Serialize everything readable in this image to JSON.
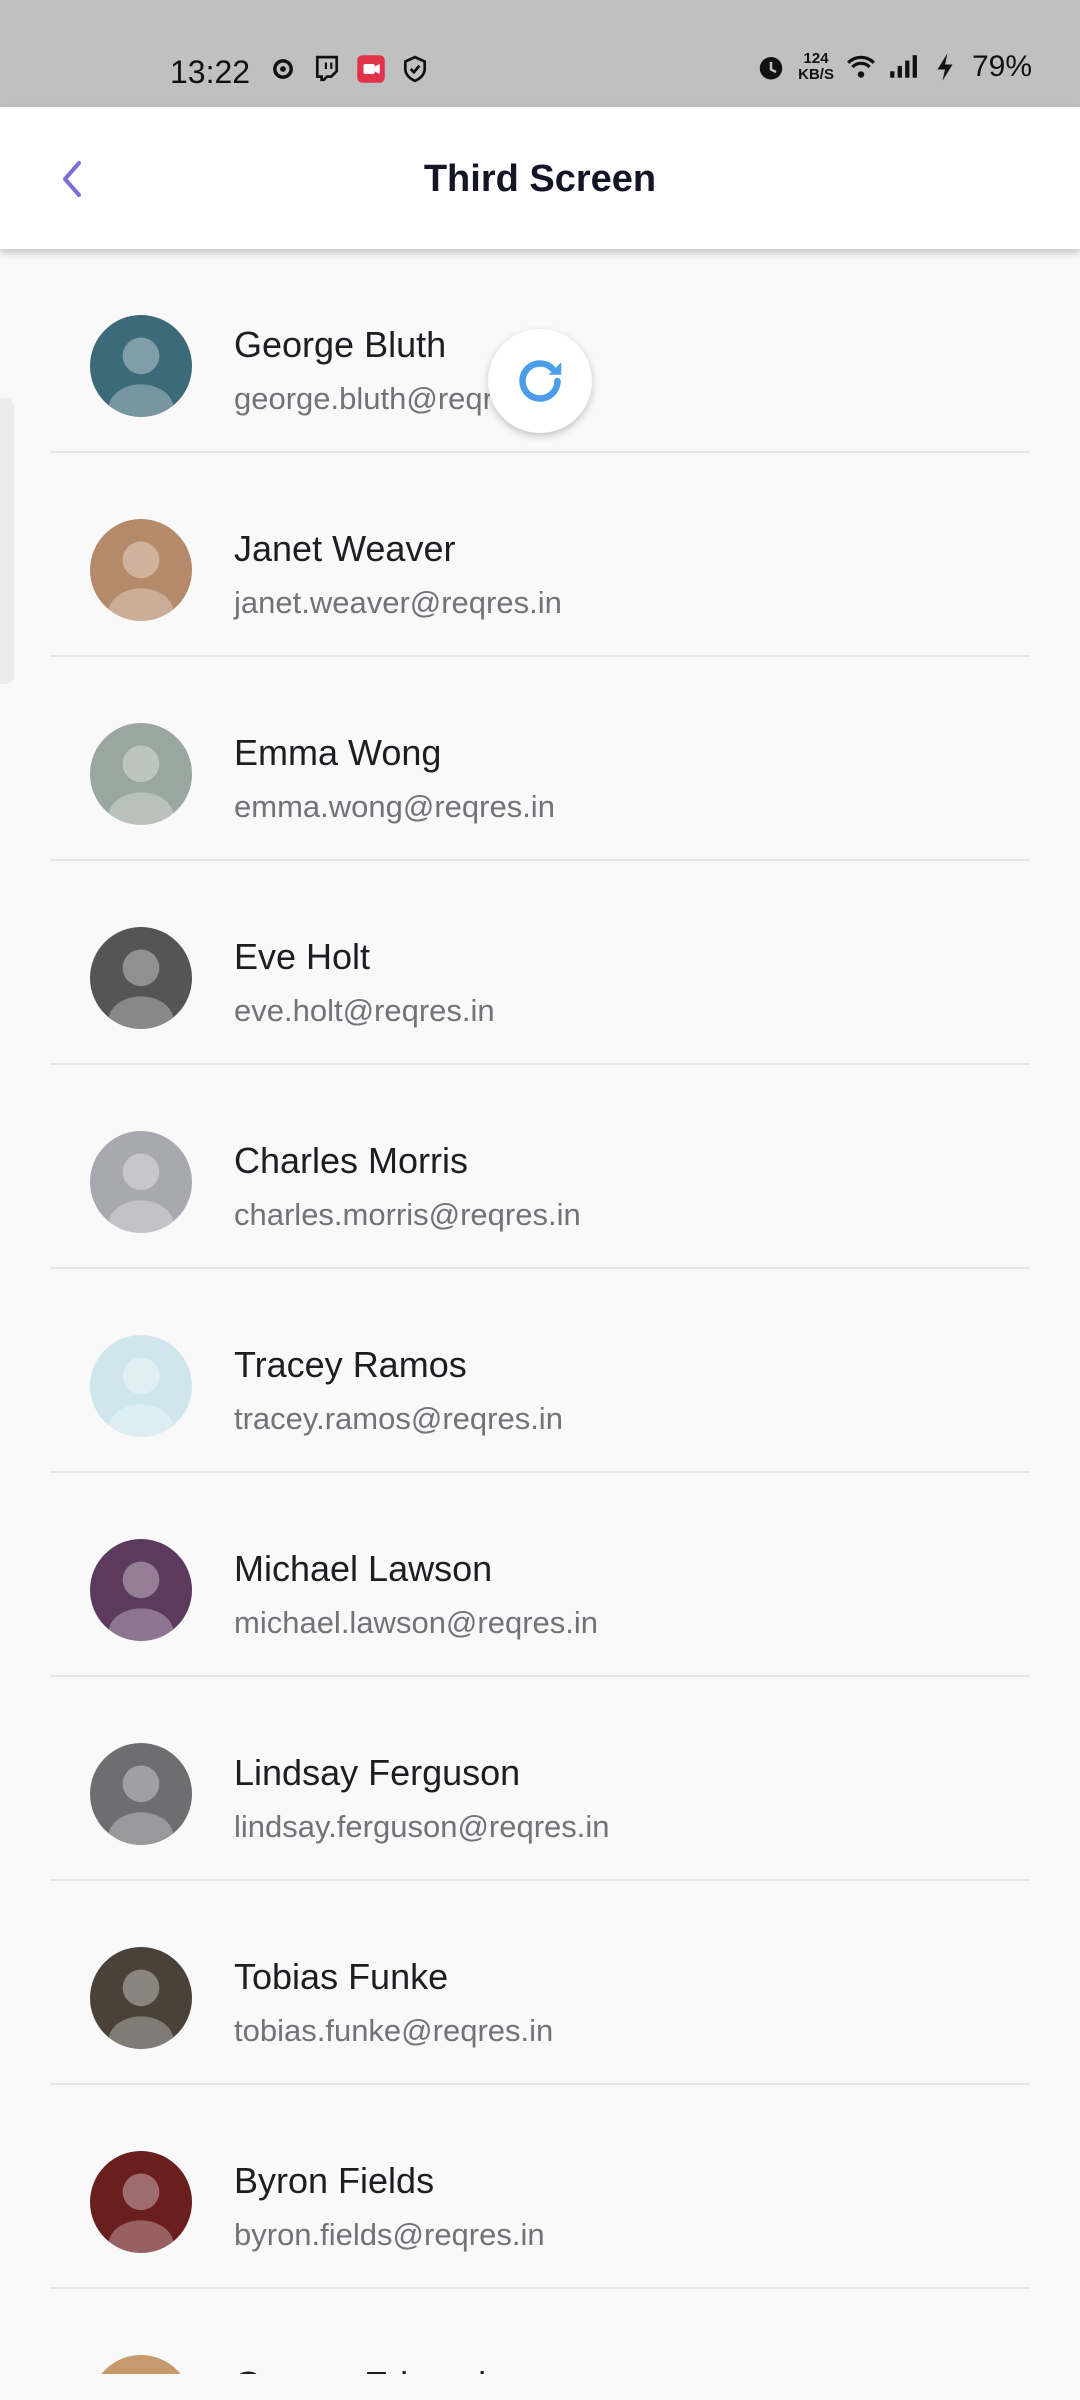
{
  "status_bar": {
    "time": "13:22",
    "net_speed_value": "124",
    "net_speed_unit": "KB/S",
    "battery": "79%"
  },
  "app_bar": {
    "title": "Third Screen",
    "back_icon": "chevron-left-icon",
    "accent_color": "#7b6fd6"
  },
  "refresh": {
    "icon": "refresh-icon",
    "color": "#4a9de8"
  },
  "users": [
    {
      "name": "George Bluth",
      "email": "george.bluth@reqres.in",
      "avatar_color": "#3d6a78"
    },
    {
      "name": "Janet Weaver",
      "email": "janet.weaver@reqres.in",
      "avatar_color": "#b58a6a"
    },
    {
      "name": "Emma Wong",
      "email": "emma.wong@reqres.in",
      "avatar_color": "#9aa7a0"
    },
    {
      "name": "Eve Holt",
      "email": "eve.holt@reqres.in",
      "avatar_color": "#555555"
    },
    {
      "name": "Charles Morris",
      "email": "charles.morris@reqres.in",
      "avatar_color": "#a8a8b0"
    },
    {
      "name": "Tracey Ramos",
      "email": "tracey.ramos@reqres.in",
      "avatar_color": "#cfe7ec"
    },
    {
      "name": "Michael Lawson",
      "email": "michael.lawson@reqres.in",
      "avatar_color": "#5b3a5e"
    },
    {
      "name": "Lindsay Ferguson",
      "email": "lindsay.ferguson@reqres.in",
      "avatar_color": "#6e6e70"
    },
    {
      "name": "Tobias Funke",
      "email": "tobias.funke@reqres.in",
      "avatar_color": "#4a4238"
    },
    {
      "name": "Byron Fields",
      "email": "byron.fields@reqres.in",
      "avatar_color": "#6a1e1e"
    },
    {
      "name": "George Edwards",
      "email": "",
      "avatar_color": "#c79a6e"
    }
  ]
}
